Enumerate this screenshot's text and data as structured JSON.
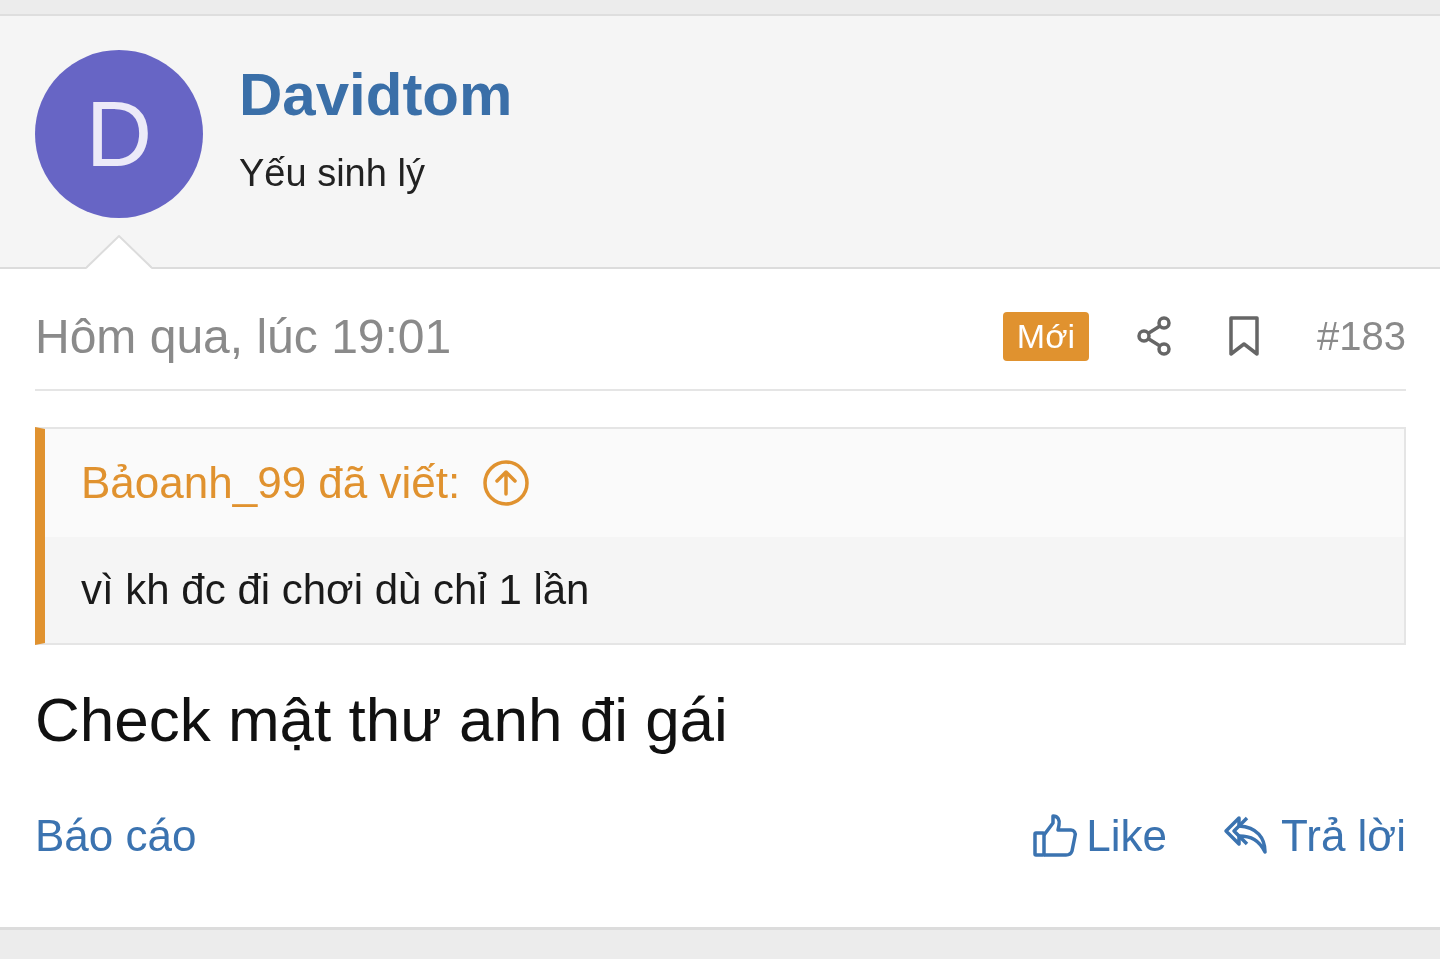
{
  "author": {
    "avatar_letter": "D",
    "name": "Davidtom",
    "title": "Yếu sinh lý"
  },
  "post": {
    "date": "Hôm qua, lúc 19:01",
    "badge": "Mới",
    "number": "#183"
  },
  "quote": {
    "source": "Bảoanh_99 đã viết:",
    "text": "vì kh đc đi chơi dù chỉ 1 lần"
  },
  "message": "Check mật thư anh đi gái",
  "actions": [
    {
      "kind": "report",
      "label": "Báo cáo"
    },
    {
      "kind": "like",
      "label": "Like"
    },
    {
      "kind": "reply",
      "label": "Trả lời"
    }
  ]
}
